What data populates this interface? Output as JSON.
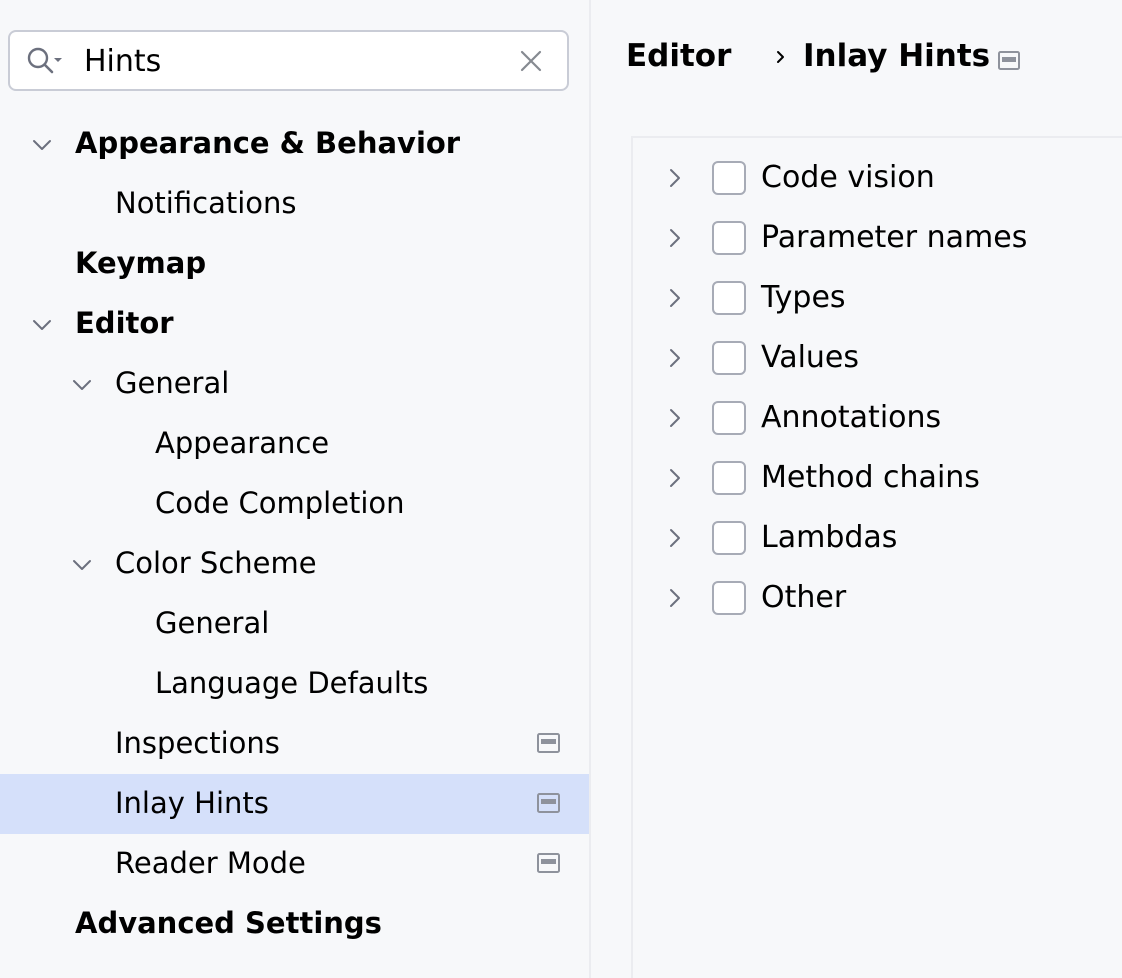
{
  "search": {
    "value": "Hints",
    "icons": {
      "search": "search-with-dropdown-icon",
      "clear": "close-icon"
    }
  },
  "tree": [
    {
      "label": "Appearance & Behavior",
      "bold": true,
      "level": 0,
      "expanded": true,
      "selected": false,
      "modified": false
    },
    {
      "label": "Notifications",
      "bold": false,
      "level": 1,
      "expanded": null,
      "selected": false,
      "modified": false
    },
    {
      "label": "Keymap",
      "bold": true,
      "level": 0,
      "expanded": null,
      "selected": false,
      "modified": false
    },
    {
      "label": "Editor",
      "bold": true,
      "level": 0,
      "expanded": true,
      "selected": false,
      "modified": false
    },
    {
      "label": "General",
      "bold": false,
      "level": 1,
      "expanded": true,
      "selected": false,
      "modified": false
    },
    {
      "label": "Appearance",
      "bold": false,
      "level": 2,
      "expanded": null,
      "selected": false,
      "modified": false
    },
    {
      "label": "Code Completion",
      "bold": false,
      "level": 2,
      "expanded": null,
      "selected": false,
      "modified": false
    },
    {
      "label": "Color Scheme",
      "bold": false,
      "level": 1,
      "expanded": true,
      "selected": false,
      "modified": false
    },
    {
      "label": "General",
      "bold": false,
      "level": 2,
      "expanded": null,
      "selected": false,
      "modified": false
    },
    {
      "label": "Language Defaults",
      "bold": false,
      "level": 2,
      "expanded": null,
      "selected": false,
      "modified": false
    },
    {
      "label": "Inspections",
      "bold": false,
      "level": 1,
      "expanded": null,
      "selected": false,
      "modified": true
    },
    {
      "label": "Inlay Hints",
      "bold": false,
      "level": 1,
      "expanded": null,
      "selected": true,
      "modified": true
    },
    {
      "label": "Reader Mode",
      "bold": false,
      "level": 1,
      "expanded": null,
      "selected": false,
      "modified": true
    },
    {
      "label": "Advanced Settings",
      "bold": true,
      "level": 0,
      "expanded": null,
      "selected": false,
      "modified": false
    }
  ],
  "breadcrumb": {
    "items": [
      "Editor",
      "Inlay Hints"
    ],
    "separator_icon": "chevron-right-icon",
    "trailing_icon": "project-settings-icon"
  },
  "hints": [
    {
      "label": "Code vision",
      "checked": false
    },
    {
      "label": "Parameter names",
      "checked": false
    },
    {
      "label": "Types",
      "checked": false
    },
    {
      "label": "Values",
      "checked": false
    },
    {
      "label": "Annotations",
      "checked": false
    },
    {
      "label": "Method chains",
      "checked": false
    },
    {
      "label": "Lambdas",
      "checked": false
    },
    {
      "label": "Other",
      "checked": false
    }
  ],
  "colors": {
    "selected_row": "#d5e0fa",
    "background": "#f7f8fa",
    "icon_gray": "#6c707e"
  }
}
